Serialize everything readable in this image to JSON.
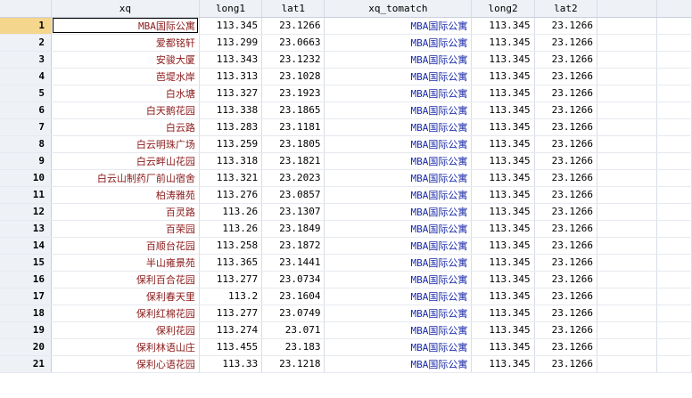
{
  "columns": [
    "",
    "xq",
    "long1",
    "lat1",
    "xq_tomatch",
    "long2",
    "lat2",
    "",
    ""
  ],
  "rows": [
    {
      "n": "1",
      "xq": "MBA国际公寓",
      "long1": "113.345",
      "lat1": "23.1266",
      "xq_tomatch": "MBA国际公寓",
      "long2": "113.345",
      "lat2": "23.1266"
    },
    {
      "n": "2",
      "xq": "爱都铭轩",
      "long1": "113.299",
      "lat1": "23.0663",
      "xq_tomatch": "MBA国际公寓",
      "long2": "113.345",
      "lat2": "23.1266"
    },
    {
      "n": "3",
      "xq": "安骏大厦",
      "long1": "113.343",
      "lat1": "23.1232",
      "xq_tomatch": "MBA国际公寓",
      "long2": "113.345",
      "lat2": "23.1266"
    },
    {
      "n": "4",
      "xq": "芭堤水岸",
      "long1": "113.313",
      "lat1": "23.1028",
      "xq_tomatch": "MBA国际公寓",
      "long2": "113.345",
      "lat2": "23.1266"
    },
    {
      "n": "5",
      "xq": "白水塘",
      "long1": "113.327",
      "lat1": "23.1923",
      "xq_tomatch": "MBA国际公寓",
      "long2": "113.345",
      "lat2": "23.1266"
    },
    {
      "n": "6",
      "xq": "白天鹅花园",
      "long1": "113.338",
      "lat1": "23.1865",
      "xq_tomatch": "MBA国际公寓",
      "long2": "113.345",
      "lat2": "23.1266"
    },
    {
      "n": "7",
      "xq": "白云路",
      "long1": "113.283",
      "lat1": "23.1181",
      "xq_tomatch": "MBA国际公寓",
      "long2": "113.345",
      "lat2": "23.1266"
    },
    {
      "n": "8",
      "xq": "白云明珠广场",
      "long1": "113.259",
      "lat1": "23.1805",
      "xq_tomatch": "MBA国际公寓",
      "long2": "113.345",
      "lat2": "23.1266"
    },
    {
      "n": "9",
      "xq": "白云畔山花园",
      "long1": "113.318",
      "lat1": "23.1821",
      "xq_tomatch": "MBA国际公寓",
      "long2": "113.345",
      "lat2": "23.1266"
    },
    {
      "n": "10",
      "xq": "白云山制药厂前山宿舍",
      "long1": "113.321",
      "lat1": "23.2023",
      "xq_tomatch": "MBA国际公寓",
      "long2": "113.345",
      "lat2": "23.1266"
    },
    {
      "n": "11",
      "xq": "柏涛雅苑",
      "long1": "113.276",
      "lat1": "23.0857",
      "xq_tomatch": "MBA国际公寓",
      "long2": "113.345",
      "lat2": "23.1266"
    },
    {
      "n": "12",
      "xq": "百灵路",
      "long1": "113.26",
      "lat1": "23.1307",
      "xq_tomatch": "MBA国际公寓",
      "long2": "113.345",
      "lat2": "23.1266"
    },
    {
      "n": "13",
      "xq": "百荣园",
      "long1": "113.26",
      "lat1": "23.1849",
      "xq_tomatch": "MBA国际公寓",
      "long2": "113.345",
      "lat2": "23.1266"
    },
    {
      "n": "14",
      "xq": "百顺台花园",
      "long1": "113.258",
      "lat1": "23.1872",
      "xq_tomatch": "MBA国际公寓",
      "long2": "113.345",
      "lat2": "23.1266"
    },
    {
      "n": "15",
      "xq": "半山雍景苑",
      "long1": "113.365",
      "lat1": "23.1441",
      "xq_tomatch": "MBA国际公寓",
      "long2": "113.345",
      "lat2": "23.1266"
    },
    {
      "n": "16",
      "xq": "保利百合花园",
      "long1": "113.277",
      "lat1": "23.0734",
      "xq_tomatch": "MBA国际公寓",
      "long2": "113.345",
      "lat2": "23.1266"
    },
    {
      "n": "17",
      "xq": "保利春天里",
      "long1": "113.2",
      "lat1": "23.1604",
      "xq_tomatch": "MBA国际公寓",
      "long2": "113.345",
      "lat2": "23.1266"
    },
    {
      "n": "18",
      "xq": "保利红棉花园",
      "long1": "113.277",
      "lat1": "23.0749",
      "xq_tomatch": "MBA国际公寓",
      "long2": "113.345",
      "lat2": "23.1266"
    },
    {
      "n": "19",
      "xq": "保利花园",
      "long1": "113.274",
      "lat1": "23.071",
      "xq_tomatch": "MBA国际公寓",
      "long2": "113.345",
      "lat2": "23.1266"
    },
    {
      "n": "20",
      "xq": "保利林语山庄",
      "long1": "113.455",
      "lat1": "23.183",
      "xq_tomatch": "MBA国际公寓",
      "long2": "113.345",
      "lat2": "23.1266"
    },
    {
      "n": "21",
      "xq": "保利心语花园",
      "long1": "113.33",
      "lat1": "23.1218",
      "xq_tomatch": "MBA国际公寓",
      "long2": "113.345",
      "lat2": "23.1266"
    }
  ],
  "selected_row": "1",
  "colors": {
    "header_bg": "#eef1f6",
    "selected_rownum": "#f5d68d",
    "string_red": "#8b1a1a",
    "string_blue": "#1a2aa8"
  }
}
